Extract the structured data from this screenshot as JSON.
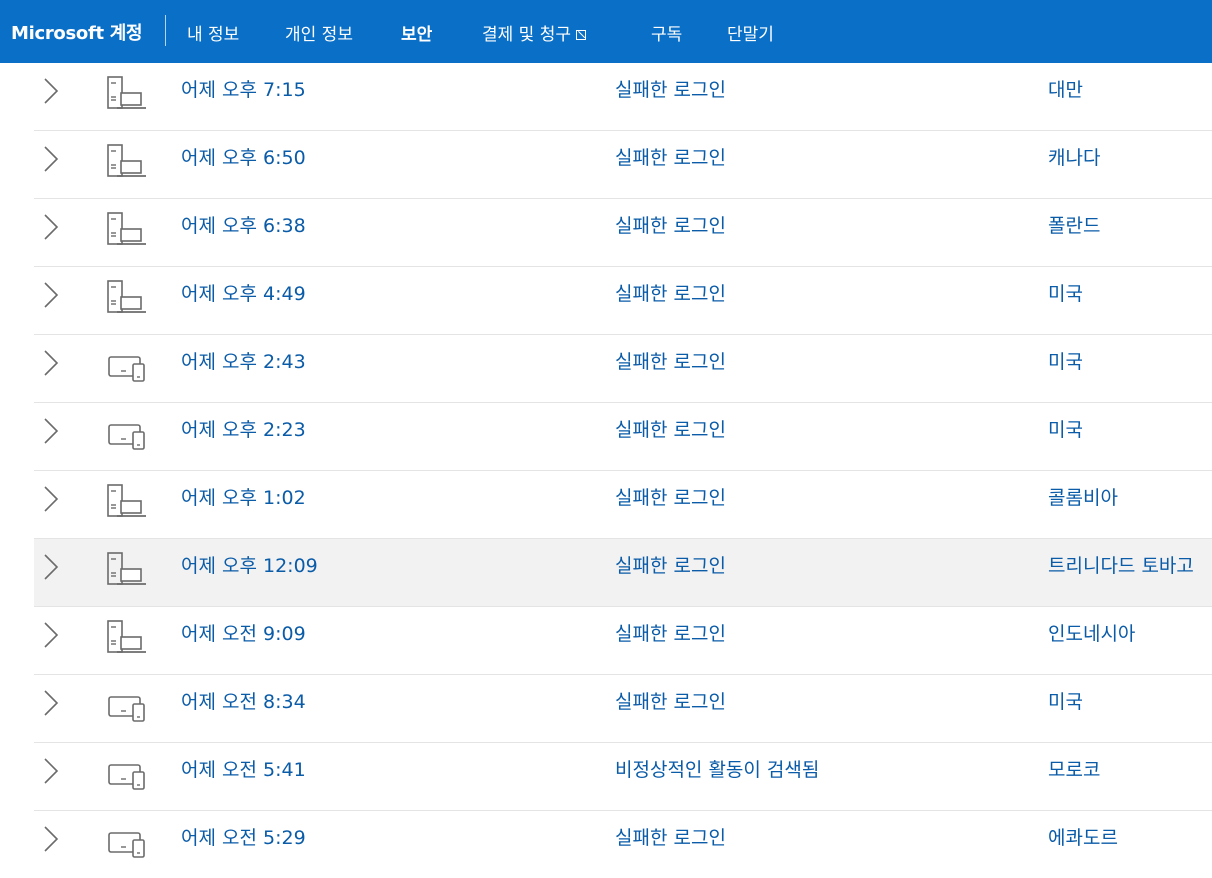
{
  "header": {
    "brand": "Microsoft 계정",
    "nav": [
      {
        "label": "내 정보",
        "active": false
      },
      {
        "label": "개인 정보",
        "active": false
      },
      {
        "label": "보안",
        "active": true
      },
      {
        "label": "결제 및 청구",
        "active": false,
        "external": true
      },
      {
        "label": "구독",
        "active": false
      },
      {
        "label": "단말기",
        "active": false
      }
    ],
    "colors": {
      "bar": "#0a6fc7",
      "text": "#ffffff"
    }
  },
  "activity": {
    "colors": {
      "link": "#0a5ba8",
      "highlight_row": "#f2f2f2",
      "icon": "#6b6b6b"
    },
    "rows": [
      {
        "time": "어제 오후 7:15",
        "event": "실패한 로그인",
        "location": "대만",
        "device_icon": "desktop-laptop-icon"
      },
      {
        "time": "어제 오후 6:50",
        "event": "실패한 로그인",
        "location": "캐나다",
        "device_icon": "desktop-laptop-icon"
      },
      {
        "time": "어제 오후 6:38",
        "event": "실패한 로그인",
        "location": "폴란드",
        "device_icon": "desktop-laptop-icon"
      },
      {
        "time": "어제 오후 4:49",
        "event": "실패한 로그인",
        "location": "미국",
        "device_icon": "desktop-laptop-icon"
      },
      {
        "time": "어제 오후 2:43",
        "event": "실패한 로그인",
        "location": "미국",
        "device_icon": "laptop-phone-icon"
      },
      {
        "time": "어제 오후 2:23",
        "event": "실패한 로그인",
        "location": "미국",
        "device_icon": "laptop-phone-icon"
      },
      {
        "time": "어제 오후 1:02",
        "event": "실패한 로그인",
        "location": "콜롬비아",
        "device_icon": "desktop-laptop-icon"
      },
      {
        "time": "어제 오후 12:09",
        "event": "실패한 로그인",
        "location": "트리니다드 토바고",
        "device_icon": "desktop-laptop-icon",
        "highlighted": true
      },
      {
        "time": "어제 오전 9:09",
        "event": "실패한 로그인",
        "location": "인도네시아",
        "device_icon": "desktop-laptop-icon"
      },
      {
        "time": "어제 오전 8:34",
        "event": "실패한 로그인",
        "location": "미국",
        "device_icon": "laptop-phone-icon"
      },
      {
        "time": "어제 오전 5:41",
        "event": "비정상적인 활동이 검색됨",
        "location": "모로코",
        "device_icon": "laptop-phone-icon"
      },
      {
        "time": "어제 오전 5:29",
        "event": "실패한 로그인",
        "location": "에콰도르",
        "device_icon": "laptop-phone-icon"
      }
    ]
  }
}
